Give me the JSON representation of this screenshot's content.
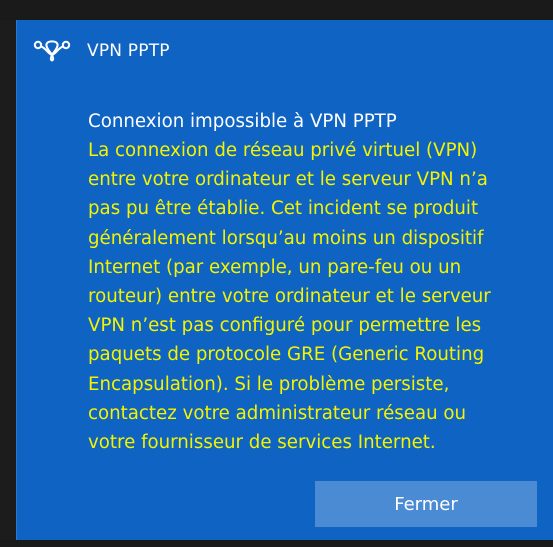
{
  "dialog": {
    "title": "VPN PPTP",
    "icon": "vpn-icon",
    "heading": "Connexion impossible à VPN PPTP",
    "body_lines": [
      "La connexion de réseau privé virtuel (VPN)",
      "entre votre ordinateur et le serveur VPN n’a",
      "pas pu être établie. Cet incident se produit",
      "généralement lorsqu’au moins un dispositif",
      "Internet (par exemple, un pare-feu ou un",
      "routeur) entre votre ordinateur et le serveur",
      "VPN n’est pas configuré pour permettre les",
      "paquets de protocole GRE (Generic Routing",
      "Encapsulation). Si le problème persiste,",
      "contactez votre administrateur réseau ou",
      "votre fournisseur de services Internet."
    ],
    "close_label": "Fermer"
  },
  "colors": {
    "dialog_background": "#0e63c3",
    "body_text": "#f4f400",
    "heading_text": "#ffffff",
    "button_background": "#4a8bd4"
  }
}
